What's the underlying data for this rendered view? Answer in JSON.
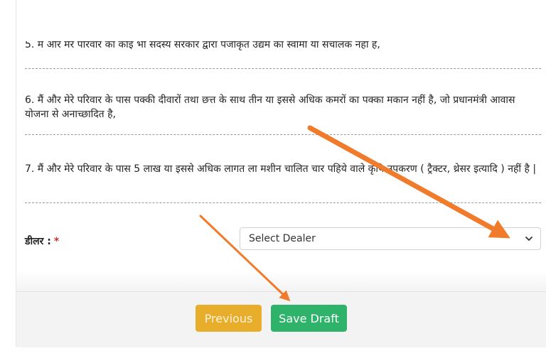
{
  "clauses": {
    "c5": "5. मैं और मेरे परिवार का कोई भी सदस्य सरकार द्वारा पंजीकृत उद्यम का स्वामी या संचालक नहीं है,",
    "c6": "6. मैं और मेरे परिवार के पास पक्की दीवारों तथा छत्त के साथ तीन या इससे अधिक कमरों का पक्का मकान नहीं है, जो प्रधानमंत्री आवास योजना से अनाच्छादित है,",
    "c7": "7. मैं और मेरे परिवार के पास 5 लाख या इससे अधिक लागत ला मशीन चालित चार पहिये वाले कृषि उपकरण ( ट्रैक्टर, थ्रेसर इत्यादि ) नहीं है |"
  },
  "dealer": {
    "label": "डीलर :",
    "required_mark": "*",
    "selected": "Select Dealer"
  },
  "buttons": {
    "previous": "Previous",
    "save_draft": "Save Draft"
  },
  "colors": {
    "previous_bg": "#e8ae2b",
    "save_bg": "#2fb36a",
    "annotation_arrow": "#f07b2a",
    "required": "#d32f2f"
  },
  "icons": {
    "select_chevron": "chevron-down-icon"
  }
}
